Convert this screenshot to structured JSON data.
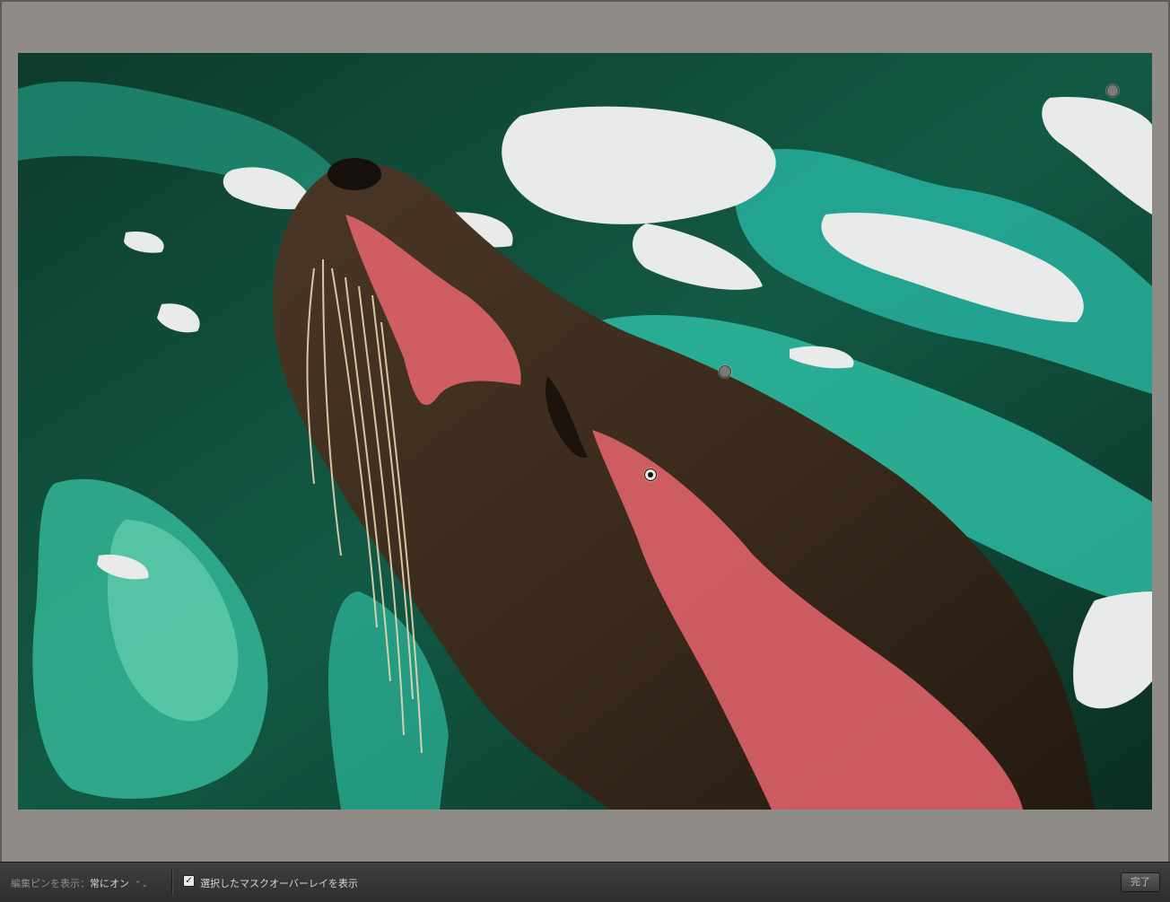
{
  "toolbar": {
    "edit_pins_label": "編集ピンを表示：",
    "edit_pins_value": "常にオン",
    "overlay_checkbox_checked": true,
    "overlay_checkbox_label": "選択したマスクオーバーレイを表示",
    "done_label": "完了"
  },
  "photo": {
    "subject": "sea-lion-in-water",
    "overlay_color": "#e8666e"
  },
  "pins": [
    {
      "name": "pin-top-right",
      "active": false
    },
    {
      "name": "pin-head",
      "active": false
    },
    {
      "name": "pin-neck-active",
      "active": true
    }
  ],
  "icons": {
    "select_arrows": "⌃⌄",
    "checkmark": "✓"
  }
}
